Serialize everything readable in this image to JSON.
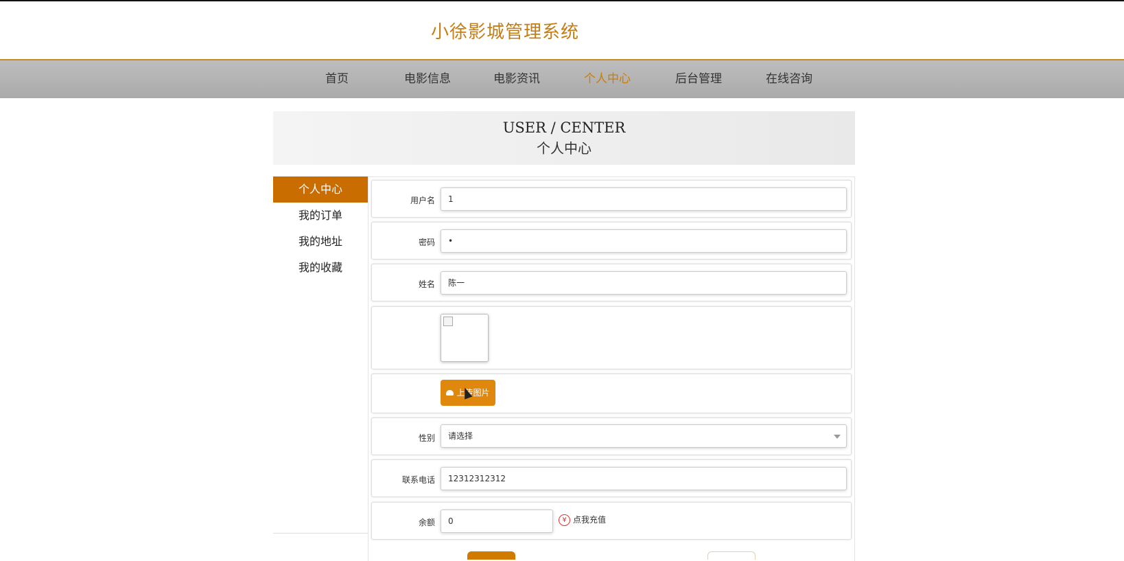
{
  "site_title": "小徐影城管理系统",
  "nav": [
    "首页",
    "电影信息",
    "电影资讯",
    "个人中心",
    "后台管理",
    "在线咨询"
  ],
  "banner": {
    "en": "USER / CENTER",
    "cn": "个人中心"
  },
  "sidebar": [
    "个人中心",
    "我的订单",
    "我的地址",
    "我的收藏"
  ],
  "form": {
    "username": {
      "label": "用户名",
      "value": "1"
    },
    "password": {
      "label": "密码",
      "value": "•"
    },
    "name": {
      "label": "姓名",
      "value": "陈一"
    },
    "upload_label": "上传图片",
    "gender": {
      "label": "性别",
      "value": "请选择"
    },
    "phone": {
      "label": "联系电话",
      "value": "12312312312"
    },
    "balance": {
      "label": "余额",
      "value": "0"
    },
    "recharge_label": "点我充值",
    "yen": "¥"
  },
  "colors": {
    "accent": "#c96d00",
    "title": "#c47d16",
    "upload": "#e0870e"
  }
}
